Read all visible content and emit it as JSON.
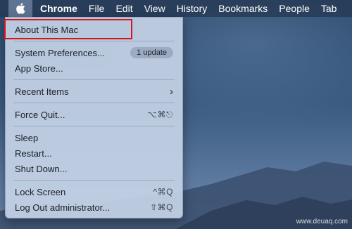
{
  "menubar": {
    "apple_icon": "apple-logo-icon",
    "items": [
      "Chrome",
      "File",
      "Edit",
      "View",
      "History",
      "Bookmarks",
      "People",
      "Tab"
    ]
  },
  "apple_menu": {
    "about": "About This Mac",
    "system_preferences": "System Preferences...",
    "update_badge": "1 update",
    "app_store": "App Store...",
    "recent_items": "Recent Items",
    "recent_items_arrow": "›",
    "force_quit": "Force Quit...",
    "force_quit_shortcut": "⌥⌘⎋",
    "sleep": "Sleep",
    "restart": "Restart...",
    "shut_down": "Shut Down...",
    "lock_screen": "Lock Screen",
    "lock_screen_shortcut": "^⌘Q",
    "log_out": "Log Out administrator...",
    "log_out_shortcut": "⇧⌘Q"
  },
  "watermark": "www.deuaq.com",
  "colors": {
    "highlight_border": "#d6141c",
    "menu_background": "#c4d2e5"
  }
}
